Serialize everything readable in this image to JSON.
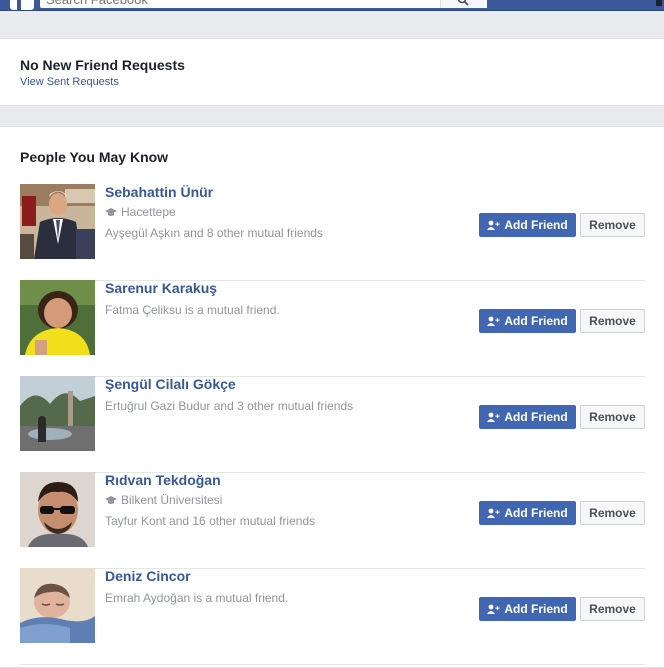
{
  "search": {
    "placeholder": "Search Facebook"
  },
  "requests": {
    "title": "No New Friend Requests",
    "link": "View Sent Requests"
  },
  "pymk": {
    "title": "People You May Know",
    "add_label": "Add Friend",
    "remove_label": "Remove",
    "people": [
      {
        "name": "Sebahattin Ünür",
        "school": "Hacettepe",
        "mutual": "Ayşegül Aşkın and 8 other mutual friends"
      },
      {
        "name": "Sarenur Karakuş",
        "school": "",
        "mutual": "Fatma Çeliksu is a mutual friend."
      },
      {
        "name": "Şengül Cilalı Gökçe",
        "school": "",
        "mutual": "Ertuğrul Gazi Budur and 3 other mutual friends"
      },
      {
        "name": "Rıdvan Tekdoğan",
        "school": "Bilkent Üniversitesi",
        "mutual": "Tayfur Kont and 16 other mutual friends"
      },
      {
        "name": "Deniz Cincor",
        "school": "",
        "mutual": "Emrah Aydoğan is a mutual friend."
      }
    ]
  },
  "colors": {
    "brand": "#3b5998",
    "button": "#4267b2",
    "link": "#365899",
    "muted": "#90949c"
  },
  "icons": [
    "facebook-logo-icon",
    "search-icon",
    "graduation-cap-icon",
    "add-friend-icon"
  ]
}
